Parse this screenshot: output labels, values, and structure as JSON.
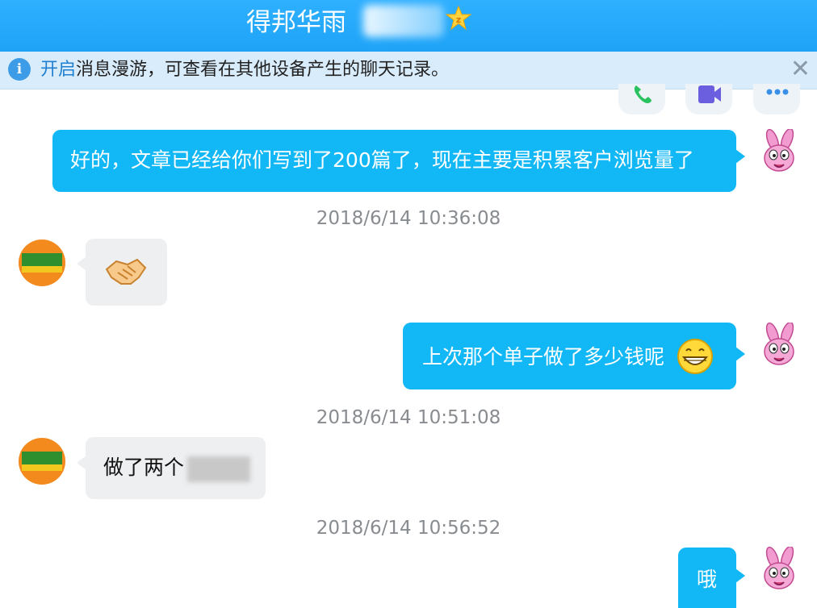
{
  "window": {
    "title": "得邦华雨",
    "badge_icon": "vip-star-badge-icon"
  },
  "notice": {
    "link_text": "开启",
    "text": "消息漫游，可查看在其他设备产生的聊天记录。",
    "close_label": "✕"
  },
  "toolbar": {
    "items": [
      "phone-call-icon",
      "video-call-icon",
      "more-options-icon"
    ]
  },
  "messages": [
    {
      "side": "out",
      "text": "好的，文章已经给你们写到了200篇了，现在主要是积累客户浏览量了"
    },
    {
      "time": "2018/6/14 10:36:08"
    },
    {
      "side": "in",
      "emoji": "handshake-emoji"
    },
    {
      "side": "out",
      "text": "上次那个单子做了多少钱呢",
      "emoji": "grin-emoji"
    },
    {
      "time": "2018/6/14 10:51:08"
    },
    {
      "side": "in",
      "text": "做了两个"
    },
    {
      "time": "2018/6/14 10:56:52"
    },
    {
      "side": "out",
      "text": "哦"
    }
  ],
  "colors": {
    "titlebar": "#1ea3f7",
    "outgoing_bubble": "#12b7f5",
    "incoming_bubble": "#eeeff1",
    "notice_bar": "#d9ecfb"
  }
}
